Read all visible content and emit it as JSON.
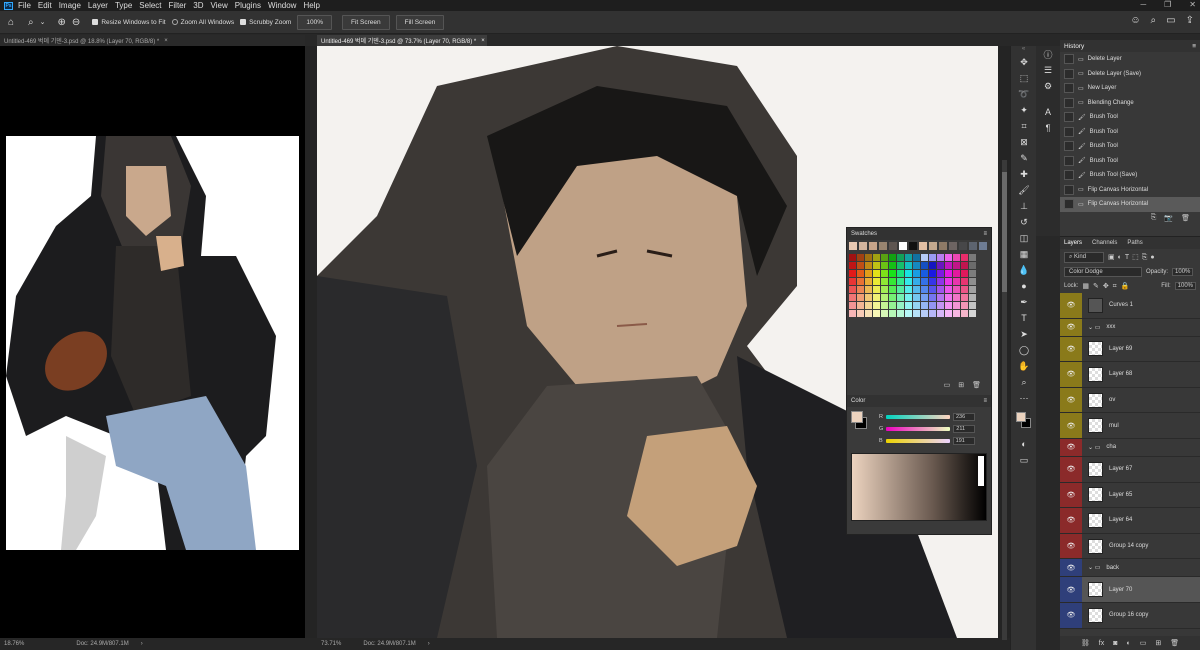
{
  "menubar": {
    "app_icon": "Ps",
    "items": [
      "File",
      "Edit",
      "Image",
      "Layer",
      "Type",
      "Select",
      "Filter",
      "3D",
      "View",
      "Plugins",
      "Window",
      "Help"
    ]
  },
  "options_bar": {
    "icons": [
      "home-icon",
      "zoom-icon",
      "zoom-in-icon",
      "zoom-out-icon"
    ],
    "resize_windows": "Resize Windows to Fit",
    "zoom_all": "Zoom All Windows",
    "scrubby_zoom": "Scrubby Zoom",
    "zoom_value": "100%",
    "fit_screen": "Fit Screen",
    "fill_screen": "Fill Screen"
  },
  "tabs": [
    {
      "label": "Untitled-469 벅뎨 기덴-3.psd @ 18.8% (Layer 70, RGB/8) *"
    },
    {
      "label": "Untitled-469 벅뎨 기덴-3.psd @ 73.7% (Layer 70, RGB/8) *"
    }
  ],
  "status_left": {
    "zoom": "18.76%",
    "doc": "Doc: 24.9M/807.1M"
  },
  "status_right": {
    "zoom": "73.71%",
    "doc": "Doc: 24.9M/807.1M"
  },
  "history": {
    "title": "History",
    "items": [
      "Delete Layer",
      "Delete Layer (Save)",
      "New Layer",
      "Blending Change",
      "Brush Tool",
      "Brush Tool",
      "Brush Tool",
      "Brush Tool",
      "Brush Tool (Save)",
      "Flip Canvas Horizontal",
      "Flip Canvas Horizontal"
    ]
  },
  "swatches": {
    "title": "Swatches"
  },
  "color": {
    "title": "Color",
    "r_label": "R",
    "g_label": "G",
    "b_label": "B",
    "r": "236",
    "g": "211",
    "b": "191",
    "fg": "#ecd3bf"
  },
  "layers_panel": {
    "tabs": [
      "Layers",
      "Channels",
      "Paths"
    ],
    "kind": "Kind",
    "blend_mode": "Color Dodge",
    "opacity_label": "Opacity:",
    "opacity": "100%",
    "lock_label": "Lock:",
    "fill_label": "Fill:",
    "fill": "100%",
    "layers": [
      {
        "name": "Curves 1",
        "color": "#8a7a1a",
        "type": "adj"
      },
      {
        "name": "xxx",
        "color": "#8a7a1a",
        "type": "group"
      },
      {
        "name": "Layer 69",
        "color": "#8a7a1a",
        "type": "layer"
      },
      {
        "name": "Layer 68",
        "color": "#8a7a1a",
        "type": "layer"
      },
      {
        "name": "ov",
        "color": "#8a7a1a",
        "type": "layer"
      },
      {
        "name": "mul",
        "color": "#8a7a1a",
        "type": "layer"
      },
      {
        "name": "cha",
        "color": "#8b2a2a",
        "type": "group"
      },
      {
        "name": "Layer 67",
        "color": "#8b2a2a",
        "type": "layer"
      },
      {
        "name": "Layer 65",
        "color": "#8b2a2a",
        "type": "layer"
      },
      {
        "name": "Layer 64",
        "color": "#8b2a2a",
        "type": "layer"
      },
      {
        "name": "Group 14 copy",
        "color": "#8b2a2a",
        "type": "layer"
      },
      {
        "name": "back",
        "color": "#2f3f7a",
        "type": "group"
      },
      {
        "name": "Layer 70",
        "color": "#2f3f7a",
        "type": "layer"
      },
      {
        "name": "Group 16 copy",
        "color": "#2f3f7a",
        "type": "layer"
      }
    ]
  }
}
